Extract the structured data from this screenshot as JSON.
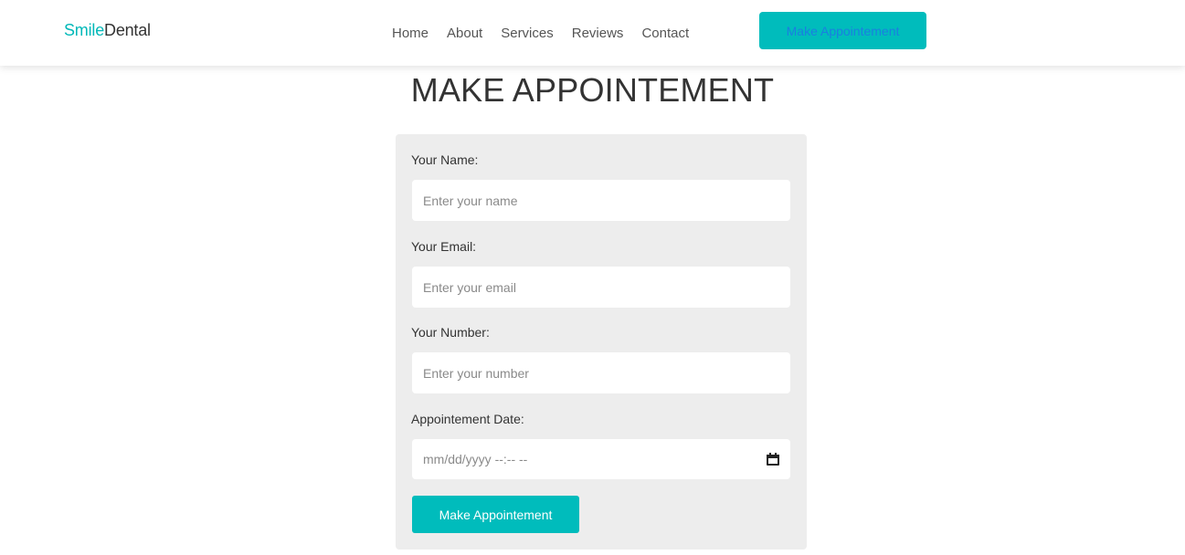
{
  "brand": {
    "accent_part": "Smile",
    "rest_part": "Dental",
    "accent_color": "#00b8b8"
  },
  "nav": {
    "links": [
      "Home",
      "About",
      "Services",
      "Reviews",
      "Contact"
    ],
    "cta_label": "Make Appointement"
  },
  "page": {
    "title": "MAKE APPOINTEMENT"
  },
  "form": {
    "name_label": "Your Name:",
    "name_placeholder": "Enter your name",
    "email_label": "Your Email:",
    "email_placeholder": "Enter your email",
    "number_label": "Your Number:",
    "number_placeholder": "Enter your number",
    "date_label": "Appointement Date:",
    "date_placeholder": "mm/dd/yyyy --:-- --",
    "date_icon": "calendar-icon",
    "submit_label": "Make Appointement"
  },
  "colors": {
    "primary": "#00bcbc",
    "card_bg": "#ededed"
  }
}
